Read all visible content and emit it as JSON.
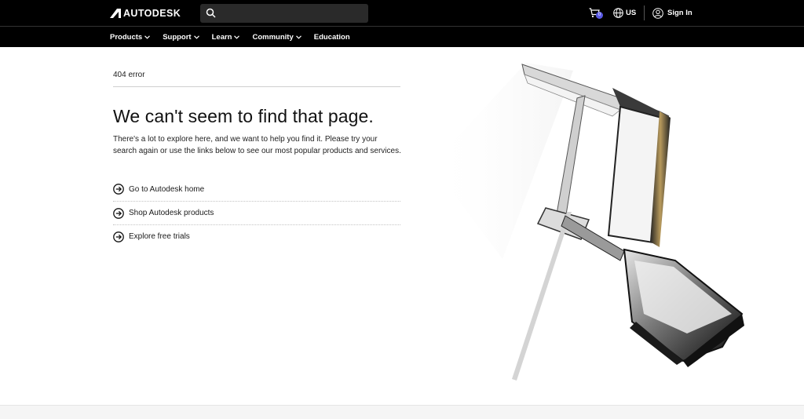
{
  "header": {
    "logo_text": "AUTODESK",
    "search_placeholder": "",
    "region": "US",
    "sign_in": "Sign In",
    "cart_count": "0"
  },
  "nav": {
    "items": [
      {
        "label": "Products",
        "has_menu": true
      },
      {
        "label": "Support",
        "has_menu": true
      },
      {
        "label": "Learn",
        "has_menu": true
      },
      {
        "label": "Community",
        "has_menu": true
      },
      {
        "label": "Education",
        "has_menu": false
      }
    ]
  },
  "main": {
    "error_code": "404 error",
    "headline": "We can't seem to find that page.",
    "description": "There's a lot to explore here, and we want to help you find it. Please try your search again or use the links below to see our most popular products and services.",
    "links": [
      {
        "label": "Go to Autodesk home"
      },
      {
        "label": "Shop Autodesk products"
      },
      {
        "label": "Explore free trials"
      }
    ]
  },
  "colors": {
    "topbar_bg": "#000000",
    "badge": "#5a5ae6",
    "page_bg": "#ffffff"
  }
}
